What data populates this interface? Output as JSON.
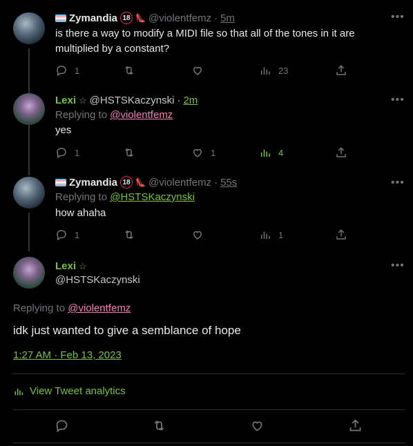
{
  "colors": {
    "background": "#000000",
    "text": "#e7e9ea",
    "muted": "#71767b",
    "accent_green": "#7ac142",
    "link_pink": "#f47fb4",
    "separator": "#2f3336"
  },
  "tweets": [
    {
      "display_name": "Zymandia",
      "badge": "18",
      "handle": "@violentfemz",
      "time": "5m",
      "text": "is there a way to modify a MIDI file so that all of the tones in it are multiplied by a constant?",
      "replies": "1",
      "views": "23"
    },
    {
      "display_name": "Lexi",
      "handle": "@HSTSKaczynski",
      "time": "2m",
      "replying_label": "Replying to",
      "replying_to": "@violentfemz",
      "text": "yes",
      "replies": "1",
      "likes": "1",
      "views": "4"
    },
    {
      "display_name": "Zymandia",
      "badge": "18",
      "handle": "@violentfemz",
      "time": "55s",
      "replying_label": "Replying to",
      "replying_to": "@HSTSKaczynski",
      "text": "how ahaha",
      "replies": "1",
      "views": "1"
    }
  ],
  "main_tweet": {
    "display_name": "Lexi",
    "handle": "@HSTSKaczynski",
    "replying_label": "Replying to",
    "replying_to": "@violentfemz",
    "text": "idk just wanted to give a semblance of hope",
    "timestamp": "1:27 AM · Feb 13, 2023",
    "analytics_label": "View Tweet analytics"
  },
  "icons": [
    "reply-icon",
    "retweet-icon",
    "like-icon",
    "views-icon",
    "share-icon",
    "more-icon",
    "verified-star-icon",
    "trans-flag-icon",
    "shoe-icon",
    "analytics-icon"
  ]
}
